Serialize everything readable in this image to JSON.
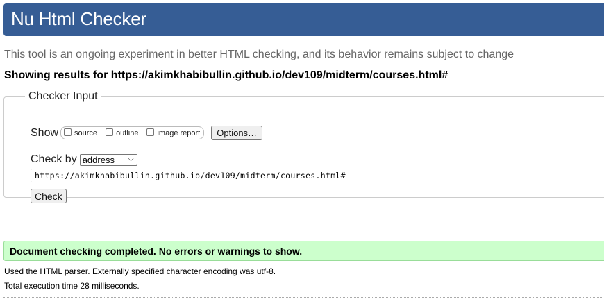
{
  "header": {
    "title": "Nu Html Checker"
  },
  "tagline": "This tool is an ongoing experiment in better HTML checking, and its behavior remains subject to change",
  "showing_results": "Showing results for https://akimkhabibullin.github.io/dev109/midterm/courses.html#",
  "checker_input": {
    "legend": "Checker Input",
    "show_label": "Show",
    "options": [
      {
        "label": "source",
        "checked": false
      },
      {
        "label": "outline",
        "checked": false
      },
      {
        "label": "image report",
        "checked": false
      }
    ],
    "options_button": "Options…",
    "check_by_label": "Check by",
    "check_by_value": "address",
    "url_value": "https://akimkhabibullin.github.io/dev109/midterm/courses.html#",
    "check_button": "Check"
  },
  "result": {
    "message": "Document checking completed. No errors or warnings to show.",
    "parser_note": "Used the HTML parser. Externally specified character encoding was utf-8.",
    "time_note": "Total execution time 28 milliseconds."
  },
  "colors": {
    "header_bg": "#365d95",
    "success_bg": "#ccffcc"
  }
}
